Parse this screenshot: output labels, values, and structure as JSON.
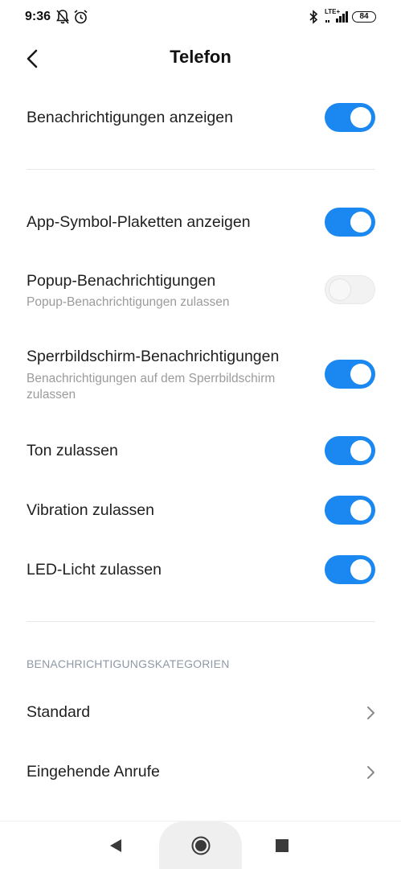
{
  "status_bar": {
    "time": "9:36",
    "network": "LTE+",
    "battery": "84",
    "icons": [
      "bell-off-icon",
      "alarm-clock-icon",
      "bluetooth-icon",
      "signal-icon",
      "battery-icon"
    ]
  },
  "header": {
    "title": "Telefon",
    "back_icon": "chevron-left-icon"
  },
  "settings": {
    "show_notifications": {
      "label": "Benachrichtigungen anzeigen",
      "enabled": true
    },
    "badges": {
      "label": "App-Symbol-Plaketten anzeigen",
      "enabled": true
    },
    "popup": {
      "label": "Popup-Benachrichtigungen",
      "sublabel": "Popup-Benachrichtigungen zulassen",
      "enabled": false
    },
    "lockscreen": {
      "label": "Sperrbildschirm-Benachrichtigungen",
      "sublabel": "Benachrichtigungen auf dem Sperrbildschirm zulassen",
      "enabled": true
    },
    "sound": {
      "label": "Ton zulassen",
      "enabled": true
    },
    "vibration": {
      "label": "Vibration zulassen",
      "enabled": true
    },
    "led": {
      "label": "LED-Licht zulassen",
      "enabled": true
    }
  },
  "categories": {
    "header": "BENACHRICHTIGUNGSKATEGORIEN",
    "items": [
      {
        "label": "Standard"
      },
      {
        "label": "Eingehende Anrufe"
      }
    ]
  },
  "colors": {
    "accent": "#1a88f0",
    "toggle_off": "#f2f2f2",
    "secondary_text": "#9b9b9b",
    "section_header": "#8f98a7"
  },
  "nav_bar": {
    "icons": [
      "back-triangle-icon",
      "home-circle-icon",
      "recents-square-icon"
    ]
  }
}
